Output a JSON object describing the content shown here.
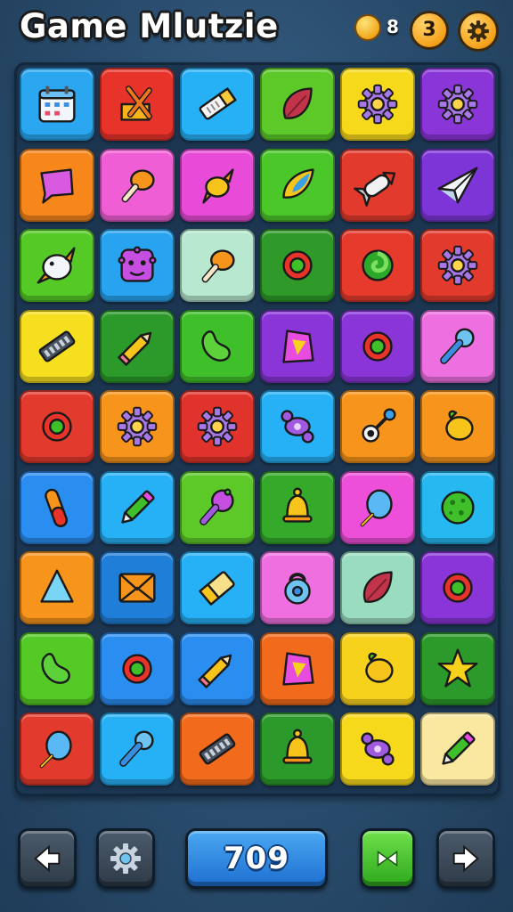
{
  "header": {
    "title": "Game Mlutzie",
    "coins": "8",
    "level": "3"
  },
  "board": {
    "rows": 9,
    "cols": 6,
    "tiles": [
      {
        "color": "#2aa7f0",
        "icon": "calendar-icon"
      },
      {
        "color": "#e8332b",
        "icon": "flag-x-icon"
      },
      {
        "color": "#26b0f5",
        "icon": "pencil-eraser-icon"
      },
      {
        "color": "#5cc928",
        "icon": "leaf-icon"
      },
      {
        "color": "#f7d91c",
        "icon": "gear-icon"
      },
      {
        "color": "#8a35d8",
        "icon": "gear-icon"
      },
      {
        "color": "#f7861b",
        "icon": "speech-bubble-icon"
      },
      {
        "color": "#f05ed6",
        "icon": "drumstick-icon"
      },
      {
        "color": "#e84bd8",
        "icon": "candy-icon"
      },
      {
        "color": "#4cc72a",
        "icon": "droplet-leaf-icon"
      },
      {
        "color": "#e23a2c",
        "icon": "rocket-icon"
      },
      {
        "color": "#7d35d8",
        "icon": "paper-plane-icon"
      },
      {
        "color": "#55c926",
        "icon": "bird-icon"
      },
      {
        "color": "#27a3ef",
        "icon": "monster-face-icon"
      },
      {
        "color": "#b8e8d0",
        "icon": "drumstick-icon"
      },
      {
        "color": "#2f9a2a",
        "icon": "ring-icon"
      },
      {
        "color": "#e53a2c",
        "icon": "swirl-icon"
      },
      {
        "color": "#e23a2c",
        "icon": "gear-icon"
      },
      {
        "color": "#f6df1f",
        "icon": "harmonica-icon"
      },
      {
        "color": "#2c9a2a",
        "icon": "pencil-icon"
      },
      {
        "color": "#3fbf2a",
        "icon": "bean-icon"
      },
      {
        "color": "#8a35d8",
        "icon": "gem-icon"
      },
      {
        "color": "#8a35d8",
        "icon": "ring-icon"
      },
      {
        "color": "#ee6fe0",
        "icon": "microphone-icon"
      },
      {
        "color": "#e23a2c",
        "icon": "ring-icon"
      },
      {
        "color": "#f7941b",
        "icon": "gear-icon"
      },
      {
        "color": "#e0332b",
        "icon": "gear-icon"
      },
      {
        "color": "#26b0f5",
        "icon": "pacifier-icon"
      },
      {
        "color": "#f7941b",
        "icon": "eye-key-icon"
      },
      {
        "color": "#f7941b",
        "icon": "lemon-icon"
      },
      {
        "color": "#2a8df0",
        "icon": "capsule-icon"
      },
      {
        "color": "#26b0f5",
        "icon": "marker-icon"
      },
      {
        "color": "#5cc928",
        "icon": "rattle-icon"
      },
      {
        "color": "#34a92a",
        "icon": "bell-icon"
      },
      {
        "color": "#ee4fd8",
        "icon": "balloon-icon"
      },
      {
        "color": "#26b8f0",
        "icon": "cookie-icon"
      },
      {
        "color": "#f7941b",
        "icon": "triangle-icon"
      },
      {
        "color": "#1f7fd8",
        "icon": "envelope-icon"
      },
      {
        "color": "#26b0f5",
        "icon": "eraser-icon"
      },
      {
        "color": "#f06fe0",
        "icon": "lock-icon"
      },
      {
        "color": "#9adcc0",
        "icon": "leaf-icon"
      },
      {
        "color": "#8a35d8",
        "icon": "ring-icon"
      },
      {
        "color": "#55c926",
        "icon": "bean-icon"
      },
      {
        "color": "#2a8df0",
        "icon": "ring-icon"
      },
      {
        "color": "#2a8df0",
        "icon": "pencil-icon"
      },
      {
        "color": "#f26a1b",
        "icon": "gem-icon"
      },
      {
        "color": "#f7d21c",
        "icon": "lemon-icon"
      },
      {
        "color": "#2c9a2a",
        "icon": "star-icon"
      },
      {
        "color": "#e23a2c",
        "icon": "balloon-icon"
      },
      {
        "color": "#26b0f5",
        "icon": "microphone-icon"
      },
      {
        "color": "#f26a1b",
        "icon": "harmonica-icon"
      },
      {
        "color": "#2c9a2a",
        "icon": "bell-icon"
      },
      {
        "color": "#f7d91c",
        "icon": "pacifier-icon"
      },
      {
        "color": "#fbe8a0",
        "icon": "marker-icon"
      }
    ]
  },
  "footer": {
    "score": "709",
    "back_icon": "arrow-left-icon",
    "settings_icon": "gear-icon",
    "shuffle_icon": "bowtie-icon",
    "next_icon": "arrow-right-icon"
  }
}
